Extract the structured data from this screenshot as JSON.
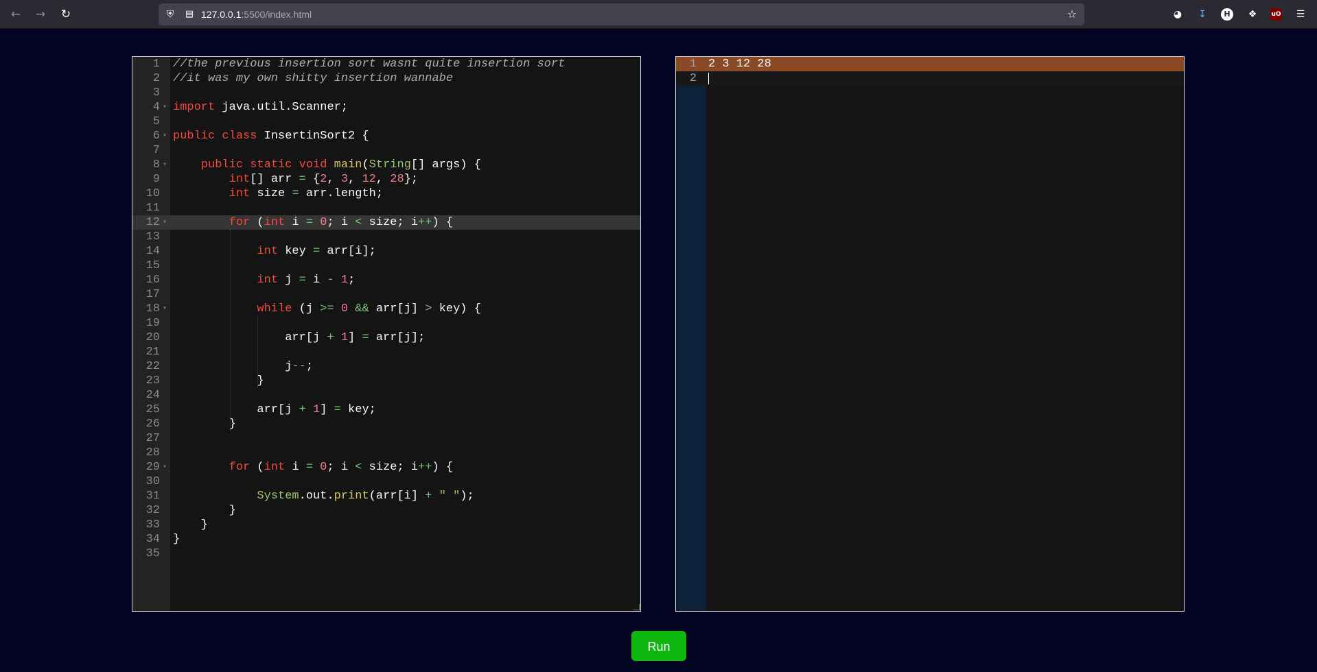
{
  "browser": {
    "url_host": "127.0.0.1",
    "url_path": ":5500/index.html"
  },
  "code_editor": {
    "lines": [
      [
        {
          "t": "com",
          "v": "//the previous insertion sort wasnt quite insertion sort"
        }
      ],
      [
        {
          "t": "com",
          "v": "//it was my own shitty insertion wannabe"
        }
      ],
      [],
      [
        {
          "t": "kw",
          "v": "import"
        },
        {
          "t": "pl",
          "v": " java.util.Scanner;"
        }
      ],
      [],
      [
        {
          "t": "kw",
          "v": "public"
        },
        {
          "t": "pl",
          "v": " "
        },
        {
          "t": "kw",
          "v": "class"
        },
        {
          "t": "pl",
          "v": " InsertinSort2 {"
        }
      ],
      [],
      [
        {
          "t": "pl",
          "v": "    "
        },
        {
          "t": "kw",
          "v": "public"
        },
        {
          "t": "pl",
          "v": " "
        },
        {
          "t": "kw",
          "v": "static"
        },
        {
          "t": "pl",
          "v": " "
        },
        {
          "t": "kw",
          "v": "void"
        },
        {
          "t": "pl",
          "v": " "
        },
        {
          "t": "fn",
          "v": "main"
        },
        {
          "t": "pl",
          "v": "("
        },
        {
          "t": "cls",
          "v": "String"
        },
        {
          "t": "pl",
          "v": "[] args) {"
        }
      ],
      [
        {
          "t": "pl",
          "v": "        "
        },
        {
          "t": "ty",
          "v": "int"
        },
        {
          "t": "pl",
          "v": "[] arr "
        },
        {
          "t": "op",
          "v": "="
        },
        {
          "t": "pl",
          "v": " {"
        },
        {
          "t": "num",
          "v": "2"
        },
        {
          "t": "pl",
          "v": ", "
        },
        {
          "t": "num",
          "v": "3"
        },
        {
          "t": "pl",
          "v": ", "
        },
        {
          "t": "num",
          "v": "12"
        },
        {
          "t": "pl",
          "v": ", "
        },
        {
          "t": "num",
          "v": "28"
        },
        {
          "t": "pl",
          "v": "};"
        }
      ],
      [
        {
          "t": "pl",
          "v": "        "
        },
        {
          "t": "ty",
          "v": "int"
        },
        {
          "t": "pl",
          "v": " size "
        },
        {
          "t": "op",
          "v": "="
        },
        {
          "t": "pl",
          "v": " arr.length;"
        }
      ],
      [],
      [
        {
          "t": "pl",
          "v": "        "
        },
        {
          "t": "kw",
          "v": "for"
        },
        {
          "t": "pl",
          "v": " ("
        },
        {
          "t": "ty",
          "v": "int"
        },
        {
          "t": "pl",
          "v": " i "
        },
        {
          "t": "op",
          "v": "="
        },
        {
          "t": "pl",
          "v": " "
        },
        {
          "t": "num",
          "v": "0"
        },
        {
          "t": "pl",
          "v": "; i "
        },
        {
          "t": "op",
          "v": "<"
        },
        {
          "t": "pl",
          "v": " size; i"
        },
        {
          "t": "op",
          "v": "++"
        },
        {
          "t": "pl",
          "v": ") {"
        }
      ],
      [],
      [
        {
          "t": "pl",
          "v": "            "
        },
        {
          "t": "ty",
          "v": "int"
        },
        {
          "t": "pl",
          "v": " key "
        },
        {
          "t": "op",
          "v": "="
        },
        {
          "t": "pl",
          "v": " arr[i];"
        }
      ],
      [],
      [
        {
          "t": "pl",
          "v": "            "
        },
        {
          "t": "ty",
          "v": "int"
        },
        {
          "t": "pl",
          "v": " j "
        },
        {
          "t": "op",
          "v": "="
        },
        {
          "t": "pl",
          "v": " i "
        },
        {
          "t": "op",
          "v": "-"
        },
        {
          "t": "pl",
          "v": " "
        },
        {
          "t": "num",
          "v": "1"
        },
        {
          "t": "pl",
          "v": ";"
        }
      ],
      [],
      [
        {
          "t": "pl",
          "v": "            "
        },
        {
          "t": "kw",
          "v": "while"
        },
        {
          "t": "pl",
          "v": " (j "
        },
        {
          "t": "op",
          "v": ">="
        },
        {
          "t": "pl",
          "v": " "
        },
        {
          "t": "num",
          "v": "0"
        },
        {
          "t": "pl",
          "v": " "
        },
        {
          "t": "op",
          "v": "&&"
        },
        {
          "t": "pl",
          "v": " arr[j] "
        },
        {
          "t": "op",
          "v": ">"
        },
        {
          "t": "pl",
          "v": " key) {"
        }
      ],
      [],
      [
        {
          "t": "pl",
          "v": "                arr[j "
        },
        {
          "t": "op",
          "v": "+"
        },
        {
          "t": "pl",
          "v": " "
        },
        {
          "t": "num",
          "v": "1"
        },
        {
          "t": "pl",
          "v": "] "
        },
        {
          "t": "op",
          "v": "="
        },
        {
          "t": "pl",
          "v": " arr[j];"
        }
      ],
      [],
      [
        {
          "t": "pl",
          "v": "                j"
        },
        {
          "t": "op",
          "v": "--"
        },
        {
          "t": "pl",
          "v": ";"
        }
      ],
      [
        {
          "t": "pl",
          "v": "            }"
        }
      ],
      [],
      [
        {
          "t": "pl",
          "v": "            arr[j "
        },
        {
          "t": "op",
          "v": "+"
        },
        {
          "t": "pl",
          "v": " "
        },
        {
          "t": "num",
          "v": "1"
        },
        {
          "t": "pl",
          "v": "] "
        },
        {
          "t": "op",
          "v": "="
        },
        {
          "t": "pl",
          "v": " key;"
        }
      ],
      [
        {
          "t": "pl",
          "v": "        }"
        }
      ],
      [],
      [],
      [
        {
          "t": "pl",
          "v": "        "
        },
        {
          "t": "kw",
          "v": "for"
        },
        {
          "t": "pl",
          "v": " ("
        },
        {
          "t": "ty",
          "v": "int"
        },
        {
          "t": "pl",
          "v": " i "
        },
        {
          "t": "op",
          "v": "="
        },
        {
          "t": "pl",
          "v": " "
        },
        {
          "t": "num",
          "v": "0"
        },
        {
          "t": "pl",
          "v": "; i "
        },
        {
          "t": "op",
          "v": "<"
        },
        {
          "t": "pl",
          "v": " size; i"
        },
        {
          "t": "op",
          "v": "++"
        },
        {
          "t": "pl",
          "v": ") {"
        }
      ],
      [],
      [
        {
          "t": "pl",
          "v": "            "
        },
        {
          "t": "cls",
          "v": "System"
        },
        {
          "t": "pl",
          "v": ".out."
        },
        {
          "t": "fn",
          "v": "print"
        },
        {
          "t": "pl",
          "v": "(arr[i] "
        },
        {
          "t": "op",
          "v": "+"
        },
        {
          "t": "pl",
          "v": " "
        },
        {
          "t": "str",
          "v": "\" \""
        },
        {
          "t": "pl",
          "v": ");"
        }
      ],
      [
        {
          "t": "pl",
          "v": "        }"
        }
      ],
      [
        {
          "t": "pl",
          "v": "    }"
        }
      ],
      [
        {
          "t": "pl",
          "v": "}"
        }
      ],
      []
    ],
    "fold_lines": [
      4,
      6,
      8,
      12,
      18,
      29
    ],
    "active_line": 12
  },
  "output_editor": {
    "lines": [
      "2 3 12 28",
      ""
    ],
    "active_line": 1,
    "colors": {
      "highlight": "#8b4a26"
    }
  },
  "run_button": {
    "label": "Run",
    "color": "#0fb70f"
  },
  "theme": {
    "page_background": "#020421"
  }
}
